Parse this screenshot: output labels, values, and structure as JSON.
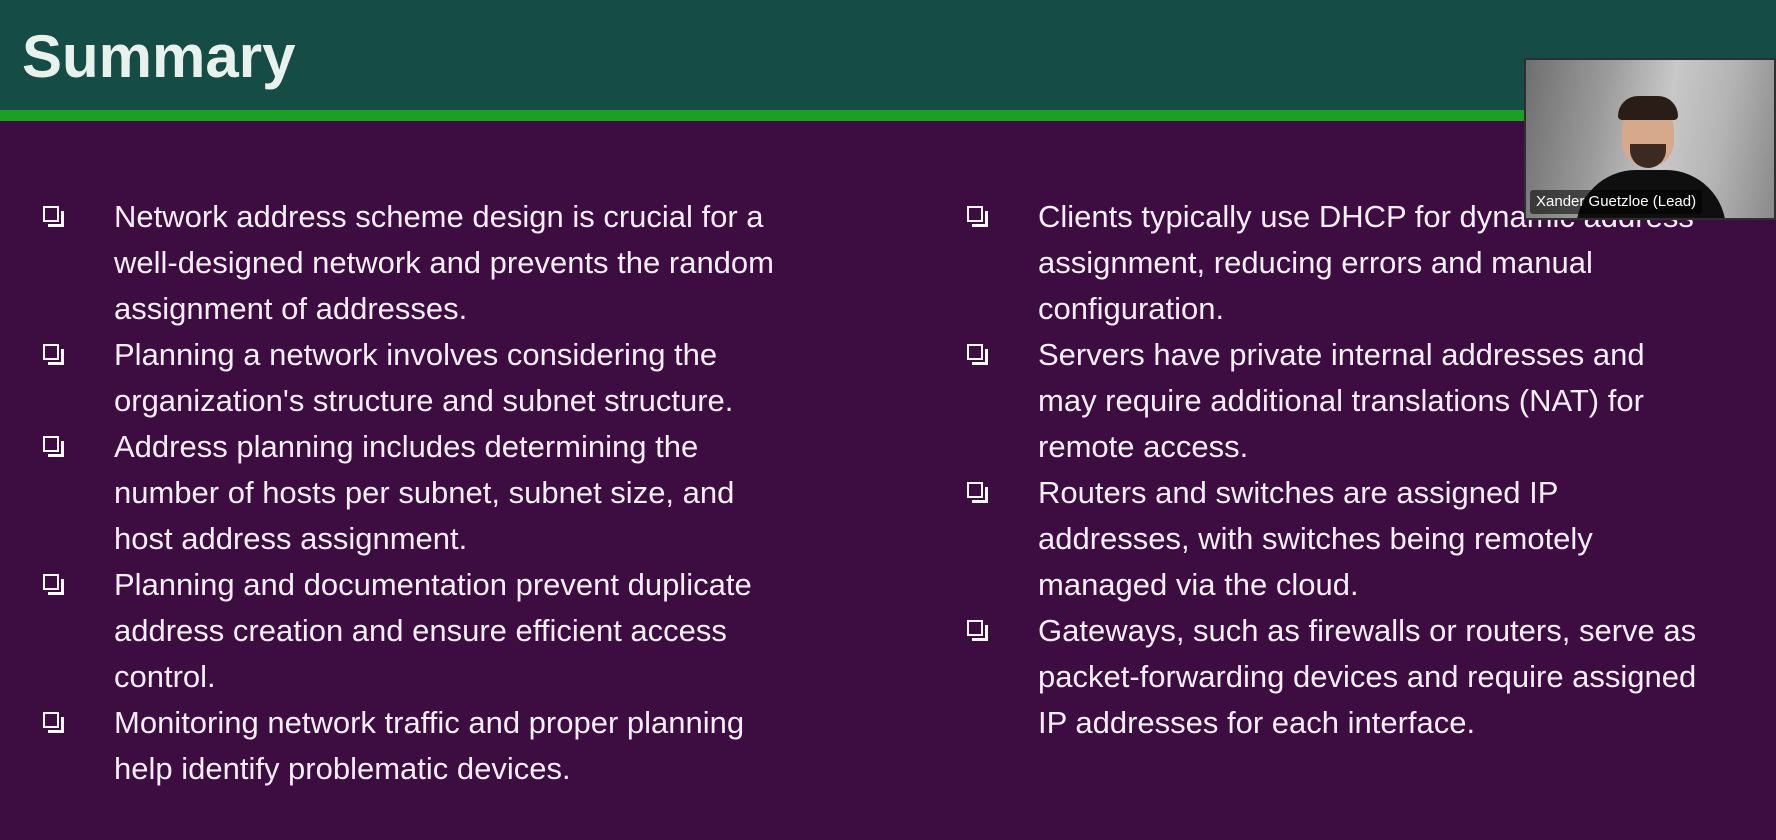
{
  "slide": {
    "title": "Summary",
    "left_column": [
      {
        "text": "Network address scheme design is crucial for a well-designed network and prevents the random assignment of addresses."
      },
      {
        "text": "Planning a network involves considering the organization's structure and subnet structure."
      },
      {
        "text": "Address planning includes determining the number of hosts per subnet, subnet size, and host address assignment."
      },
      {
        "text": "Planning and documentation prevent duplicate address creation and ensure efficient access control."
      },
      {
        "text": "Monitoring network traffic and proper planning help identify problematic devices."
      }
    ],
    "right_column": [
      {
        "text": "Clients typically use DHCP for dynamic address assignment, reducing errors and manual configuration."
      },
      {
        "text": "Servers have private internal addresses and may require additional translations (NAT) for remote access."
      },
      {
        "text": "Routers and switches are assigned IP addresses, with switches being remotely managed via the cloud."
      },
      {
        "text": "Gateways, such as firewalls or routers, serve as packet-forwarding devices and require assigned IP addresses for each interface."
      }
    ]
  },
  "video": {
    "participant_name": "Xander Guetzloe (Lead)"
  },
  "colors": {
    "header": "#154c45",
    "accent_rule": "#1aa024",
    "background": "#3d0c40",
    "text": "#f3eef4"
  },
  "icons": {
    "bullet": "checkbox-icon"
  }
}
